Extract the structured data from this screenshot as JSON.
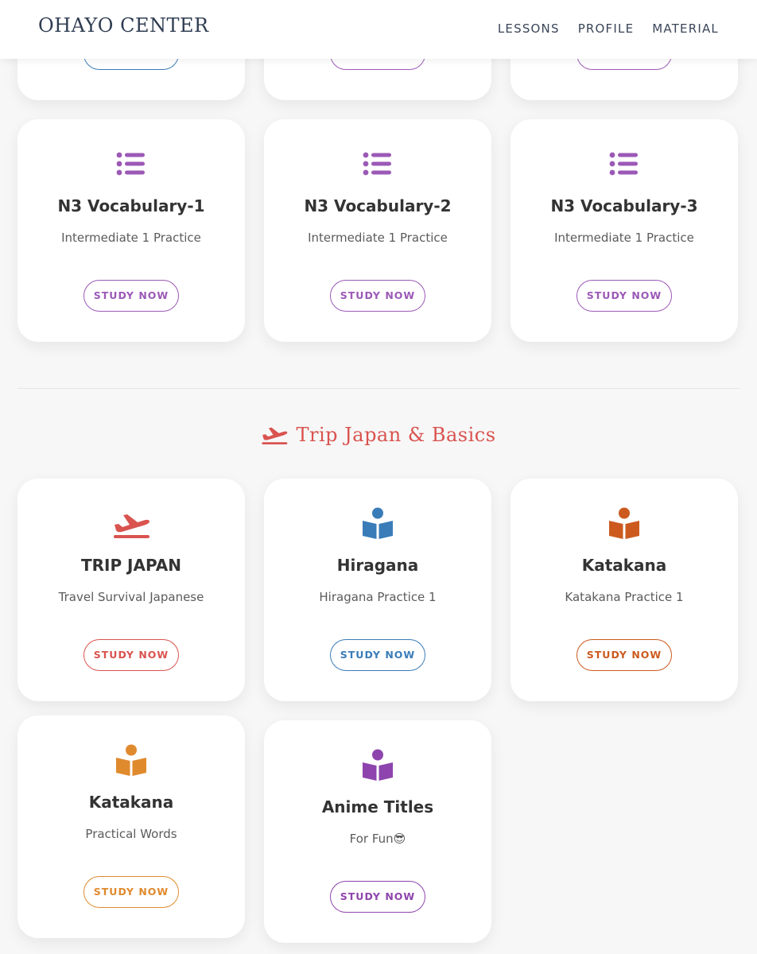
{
  "header": {
    "brand": "OHAYO CENTER",
    "nav": [
      "LESSONS",
      "PROFILE",
      "MATERIAL"
    ]
  },
  "colors": {
    "purple": "#9b59b6",
    "blue": "#3a7cb8",
    "red": "#d9534f",
    "dark_orange": "#cc5a1e",
    "orange": "#e08a2e",
    "violet": "#8e44ad"
  },
  "section": {
    "title": "Trip Japan & Basics",
    "icon": "plane-departure-icon"
  },
  "n3_cards": [
    {
      "title": "N3 Vocabulary-1",
      "subtitle": "Intermediate 1 Practice",
      "button": "STUDY NOW",
      "icon": "list-icon"
    },
    {
      "title": "N3 Vocabulary-2",
      "subtitle": "Intermediate 1 Practice",
      "button": "STUDY NOW",
      "icon": "list-icon"
    },
    {
      "title": "N3 Vocabulary-3",
      "subtitle": "Intermediate 1 Practice",
      "button": "STUDY NOW",
      "icon": "list-icon"
    }
  ],
  "basics_cards": [
    {
      "title": "TRIP JAPAN",
      "subtitle": "Travel Survival Japanese",
      "button": "STUDY NOW",
      "icon": "plane-departure-icon"
    },
    {
      "title": "Hiragana",
      "subtitle": "Hiragana Practice 1",
      "button": "STUDY NOW",
      "icon": "book-reader-icon"
    },
    {
      "title": "Katakana",
      "subtitle": "Katakana Practice 1",
      "button": "STUDY NOW",
      "icon": "book-reader-icon"
    },
    {
      "title": "Katakana",
      "subtitle": "Practical Words",
      "button": "STUDY NOW",
      "icon": "book-reader-icon"
    },
    {
      "title": "Anime Titles",
      "subtitle": "For Fun😎",
      "button": "STUDY NOW",
      "icon": "book-reader-icon"
    }
  ]
}
